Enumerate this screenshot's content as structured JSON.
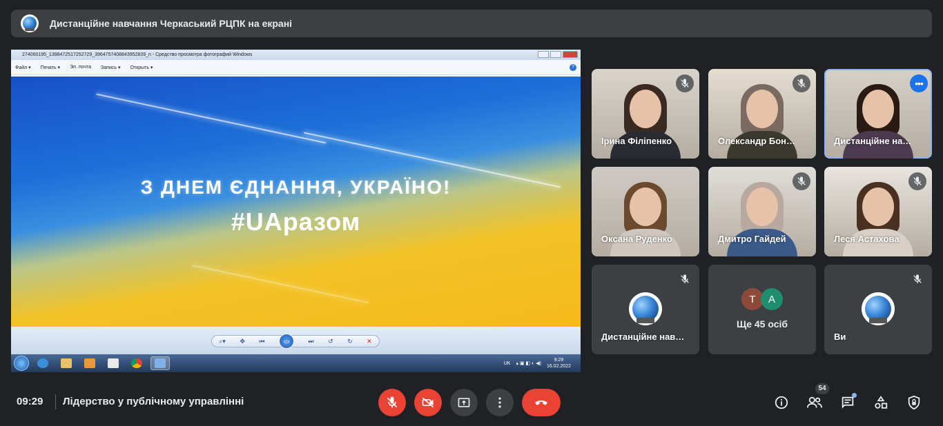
{
  "header": {
    "title": "Дистанційне навчання Черкаський РЦПК на екрані"
  },
  "shared_screen": {
    "window_title": "274060195_1398472517252729_3964757408843952839_n - Средство просмотра фотографий Windows",
    "menu": [
      "Файл ▾",
      "Печать ▾",
      "Эл. почта",
      "Запись ▾",
      "Открыть ▾"
    ],
    "help": "?",
    "headline": "З ДНЕМ ЄДНАННЯ, УКРАЇНО!",
    "hashtag": "#UAразом",
    "tray": {
      "lang": "UK",
      "time": "9:29",
      "date": "16.02.2022"
    }
  },
  "participants": [
    {
      "name": "Ірина Філіпенко",
      "muted": true,
      "hair": "#3a2a22",
      "body": "#2b2b33",
      "bg": "#d9d4cc"
    },
    {
      "name": "Олександр Бон…",
      "muted": true,
      "hair": "#7a6a60",
      "body": "#3c3a30",
      "bg": "#e4ddd0"
    },
    {
      "name": "Дистанційне на…",
      "muted": false,
      "hair": "#2a1a14",
      "body": "#4b3a50",
      "bg": "#d6d0c8"
    },
    {
      "name": "Оксана Руденко",
      "muted": false,
      "hair": "#6b4a30",
      "body": "#cfc7bf",
      "bg": "#cfcac4"
    },
    {
      "name": "Дмитро Гайдей",
      "muted": true,
      "hair": "#b8a8a0",
      "body": "#3b5a8a",
      "bg": "#e0ddd8"
    },
    {
      "name": "Леся Астахова",
      "muted": true,
      "hair": "#4a3020",
      "body": "#d8d0c8",
      "bg": "#e8e4de"
    }
  ],
  "account_tiles": [
    {
      "name": "Дистанційне нав…",
      "muted": true
    },
    {
      "name": "Ви",
      "muted": true
    }
  ],
  "more_tile": {
    "avatars": [
      {
        "letter": "Т",
        "color": "#8d4a3a"
      },
      {
        "letter": "А",
        "color": "#1e8e6e"
      }
    ],
    "label": "Ще 45 осіб"
  },
  "bottom_bar": {
    "time": "09:29",
    "meeting_name": "Лідерство у публічному управлінні",
    "participants_count": "54"
  },
  "colors": {
    "accent": "#8ab4f8",
    "danger": "#ea4335",
    "surface": "#3c4043",
    "background": "#202124"
  }
}
